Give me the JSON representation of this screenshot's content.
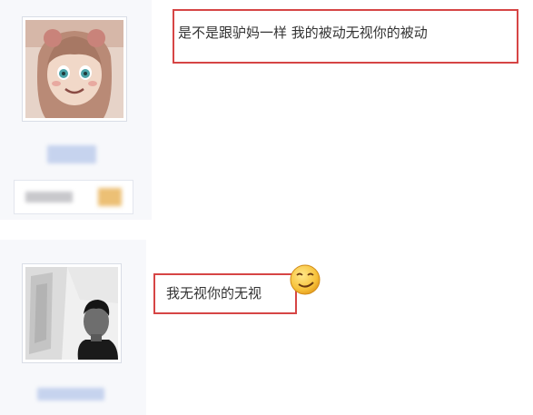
{
  "posts": [
    {
      "message": "是不是跟驴妈一样 我的被动无视你的被动"
    },
    {
      "message": "我无视你的无视"
    }
  ],
  "icons": {
    "avatar_1": "anime-girl-avatar-icon",
    "avatar_2": "man-portrait-avatar-icon",
    "emoticon": "smirk-emoticon-icon"
  },
  "colors": {
    "highlight_border": "#d64545",
    "sidebar_bg": "#f7f8fb",
    "text": "#333333"
  }
}
